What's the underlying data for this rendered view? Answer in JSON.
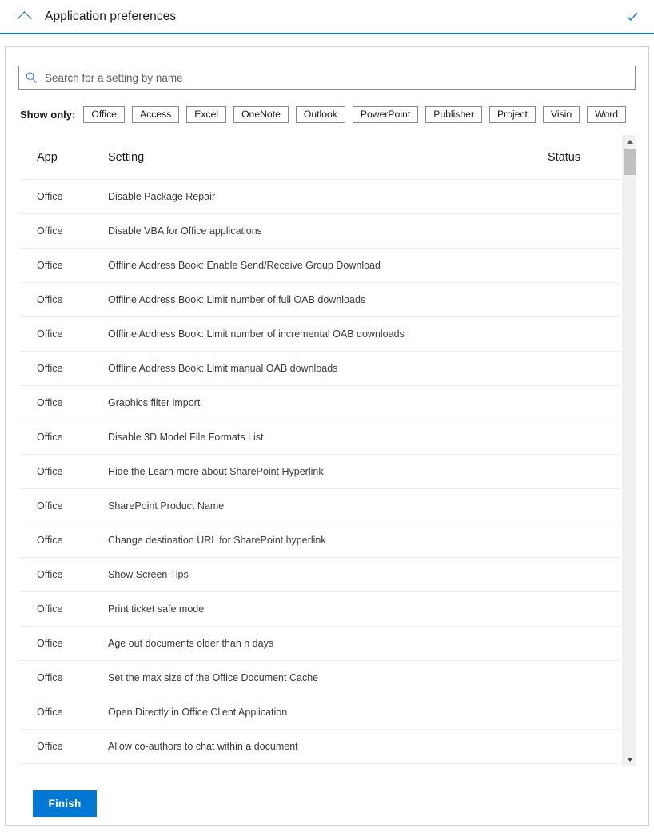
{
  "header": {
    "title": "Application preferences",
    "collapse_icon": "chevron-up-icon",
    "status_icon": "checkmark-icon",
    "accent_color": "#0078d4"
  },
  "search": {
    "icon": "search-icon",
    "placeholder": "Search for a setting by name",
    "value": ""
  },
  "filter": {
    "label": "Show only:",
    "chips": [
      {
        "label": "Office"
      },
      {
        "label": "Access"
      },
      {
        "label": "Excel"
      },
      {
        "label": "OneNote"
      },
      {
        "label": "Outlook"
      },
      {
        "label": "PowerPoint"
      },
      {
        "label": "Publisher"
      },
      {
        "label": "Project"
      },
      {
        "label": "Visio"
      },
      {
        "label": "Word"
      }
    ]
  },
  "table": {
    "columns": [
      "App",
      "Setting",
      "Status"
    ],
    "rows": [
      {
        "app": "Office",
        "setting": "Disable Package Repair",
        "status": ""
      },
      {
        "app": "Office",
        "setting": "Disable VBA for Office applications",
        "status": ""
      },
      {
        "app": "Office",
        "setting": "Offline Address Book: Enable Send/Receive Group Download",
        "status": ""
      },
      {
        "app": "Office",
        "setting": "Offline Address Book: Limit number of full OAB downloads",
        "status": ""
      },
      {
        "app": "Office",
        "setting": "Offline Address Book: Limit number of incremental OAB downloads",
        "status": ""
      },
      {
        "app": "Office",
        "setting": "Offline Address Book: Limit manual OAB downloads",
        "status": ""
      },
      {
        "app": "Office",
        "setting": "Graphics filter import",
        "status": ""
      },
      {
        "app": "Office",
        "setting": "Disable 3D Model File Formats List",
        "status": ""
      },
      {
        "app": "Office",
        "setting": "Hide the Learn more about SharePoint Hyperlink",
        "status": ""
      },
      {
        "app": "Office",
        "setting": "SharePoint Product Name",
        "status": ""
      },
      {
        "app": "Office",
        "setting": "Change destination URL for SharePoint hyperlink",
        "status": ""
      },
      {
        "app": "Office",
        "setting": "Show Screen Tips",
        "status": ""
      },
      {
        "app": "Office",
        "setting": "Print ticket safe mode",
        "status": ""
      },
      {
        "app": "Office",
        "setting": "Age out documents older than n days",
        "status": ""
      },
      {
        "app": "Office",
        "setting": "Set the max size of the Office Document Cache",
        "status": ""
      },
      {
        "app": "Office",
        "setting": "Open Directly in Office Client Application",
        "status": ""
      },
      {
        "app": "Office",
        "setting": "Allow co-authors to chat within a document",
        "status": ""
      }
    ]
  },
  "scrollbar": {
    "up_icon": "triangle-up-icon",
    "down_icon": "triangle-down-icon"
  },
  "footer": {
    "finish_label": "Finish",
    "finish_color": "#0078d4"
  }
}
